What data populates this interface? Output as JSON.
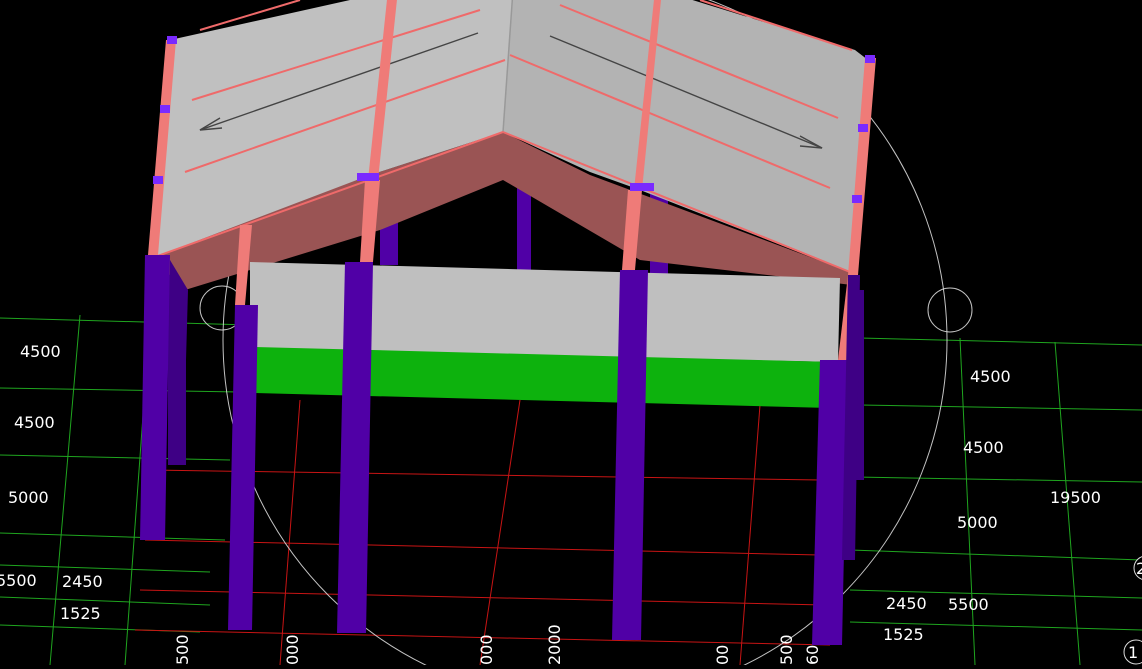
{
  "viewport": {
    "dimension_labels": {
      "left": [
        "4500",
        "4500",
        "5000",
        "5500",
        "2450",
        "1525"
      ],
      "right": [
        "4500",
        "4500",
        "5000",
        "2450",
        "5500",
        "1525"
      ],
      "total": "19500",
      "bottom": [
        "500",
        "000",
        "000",
        "2000",
        "00",
        "500",
        "60"
      ]
    },
    "axis_bubbles": [
      "1",
      "2"
    ]
  },
  "colors": {
    "column": "#5000a6",
    "beam": "#ef7b78",
    "roof": "#c0c0c0",
    "slab_edge": "#0db20d",
    "grid_major": "#1fa51f",
    "grid_minor": "#c81414"
  }
}
